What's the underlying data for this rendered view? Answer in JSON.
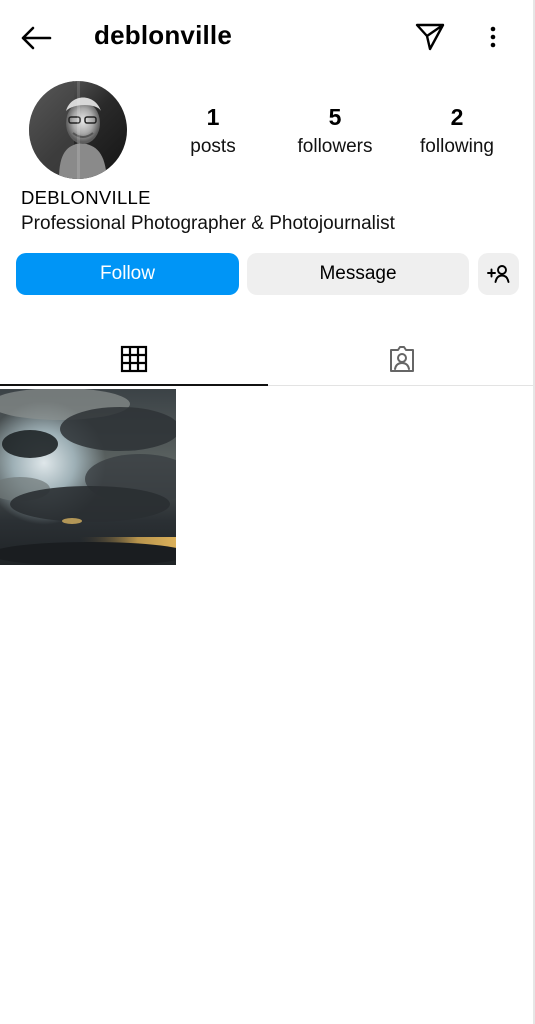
{
  "header": {
    "username": "deblonville",
    "back_icon": "arrow-left-icon",
    "send_icon": "paper-plane-icon",
    "more_icon": "more-vertical-icon"
  },
  "profile": {
    "stats": {
      "posts": {
        "value": "1",
        "label": "posts"
      },
      "followers": {
        "value": "5",
        "label": "followers"
      },
      "following": {
        "value": "2",
        "label": "following"
      }
    },
    "display_name": "DEBLONVILLE",
    "bio": "Professional Photographer & Photojournalist"
  },
  "actions": {
    "follow_label": "Follow",
    "message_label": "Message",
    "add_user_icon": "add-person-icon"
  },
  "tabs": [
    {
      "name": "grid",
      "icon": "grid-icon",
      "selected": true
    },
    {
      "name": "tagged",
      "icon": "tagged-person-icon",
      "selected": false
    }
  ],
  "colors": {
    "accent": "#0095f6",
    "button_secondary": "#efefef",
    "text": "#000000"
  }
}
